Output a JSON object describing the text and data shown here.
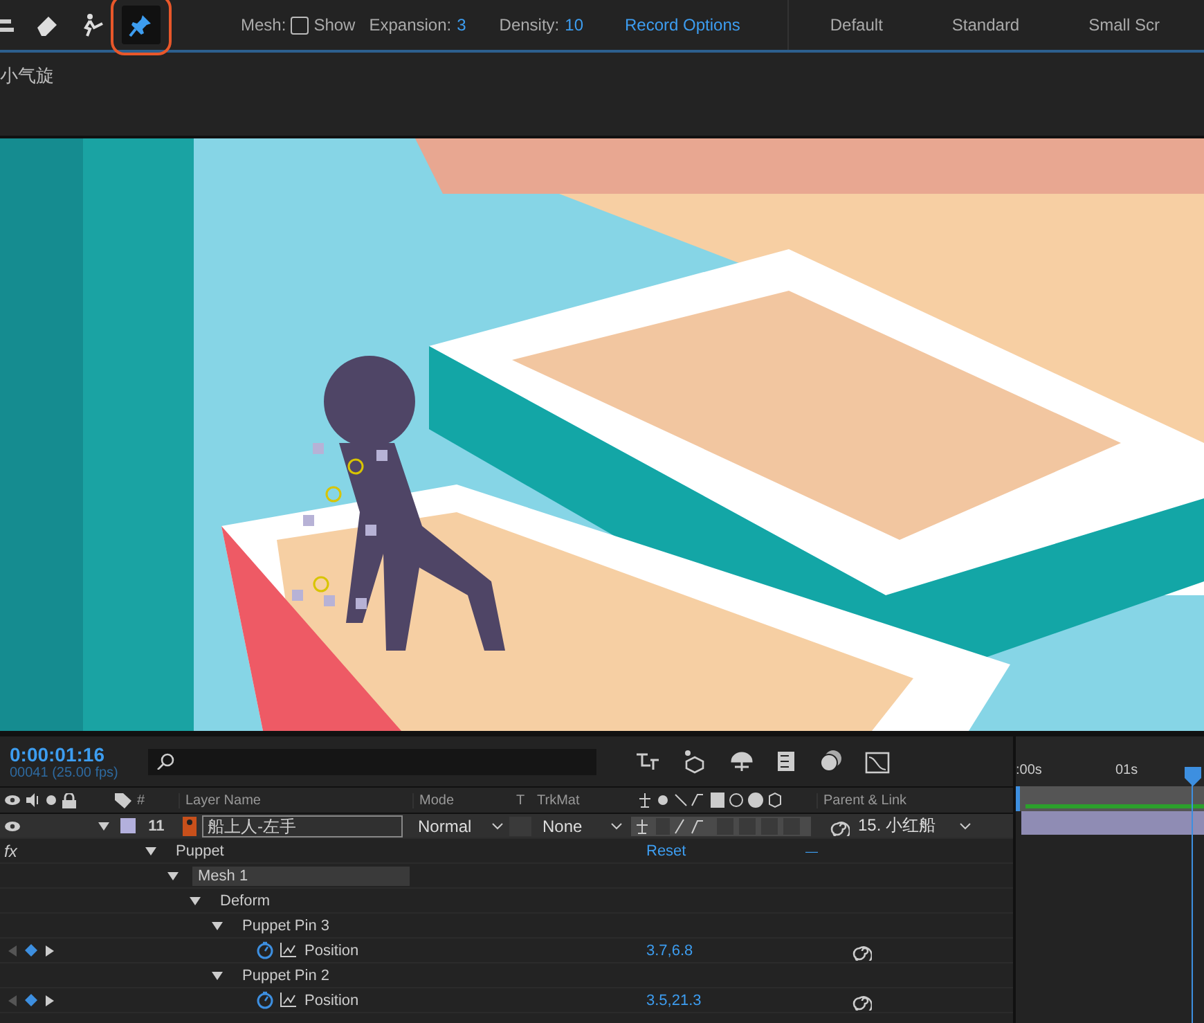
{
  "toolbar": {
    "tools": [
      {
        "kind": "selection",
        "selected": false,
        "highlighted": false
      },
      {
        "kind": "eraser",
        "selected": false,
        "highlighted": false
      },
      {
        "kind": "starch",
        "selected": false,
        "highlighted": false
      },
      {
        "kind": "pin",
        "selected": true,
        "highlighted": true
      }
    ],
    "mesh_label": "Mesh:",
    "show": {
      "label": "Show",
      "checked": false
    },
    "expansion": {
      "label": "Expansion:",
      "value": "3"
    },
    "density": {
      "label": "Density:",
      "value": "10"
    },
    "record_options": "Record Options",
    "workspaces": [
      "Default",
      "Standard",
      "Small Scr"
    ]
  },
  "composition_tab": "小气旋",
  "timeline": {
    "timecode": "0:00:01:16",
    "frames": "00041 (25.00 fps)",
    "columns": {
      "number": "#",
      "layer_name": "Layer Name",
      "mode": "Mode",
      "t": "T",
      "trkmat": "TrkMat",
      "parent": "Parent & Link"
    },
    "ruler": [
      ":00s",
      "01s"
    ],
    "layer": {
      "number": "11",
      "name": "船上人-左手",
      "color": "#b3b0dd",
      "expanded": true,
      "mode": "Normal",
      "trkmat": "None",
      "parent": "15. 小红船"
    },
    "properties": [
      {
        "kind": "group",
        "name": "Puppet",
        "expanded": true,
        "value": "Reset",
        "extra": "—",
        "fx_label": "fx",
        "children": [
          {
            "kind": "group",
            "name": "Mesh 1",
            "expanded": true,
            "highlighted": true,
            "children": [
              {
                "kind": "group",
                "name": "Deform",
                "expanded": true,
                "children": [
                  {
                    "kind": "group",
                    "name": "Puppet Pin 3",
                    "expanded": true,
                    "children": [
                      {
                        "kind": "property",
                        "name": "Position",
                        "value": "3.7,6.8",
                        "keyframe": true
                      }
                    ]
                  },
                  {
                    "kind": "group",
                    "name": "Puppet Pin 2",
                    "expanded": true,
                    "children": [
                      {
                        "kind": "property",
                        "name": "Position",
                        "value": "3.5,21.3",
                        "keyframe": true
                      }
                    ]
                  }
                ]
              }
            ]
          }
        ]
      }
    ]
  }
}
